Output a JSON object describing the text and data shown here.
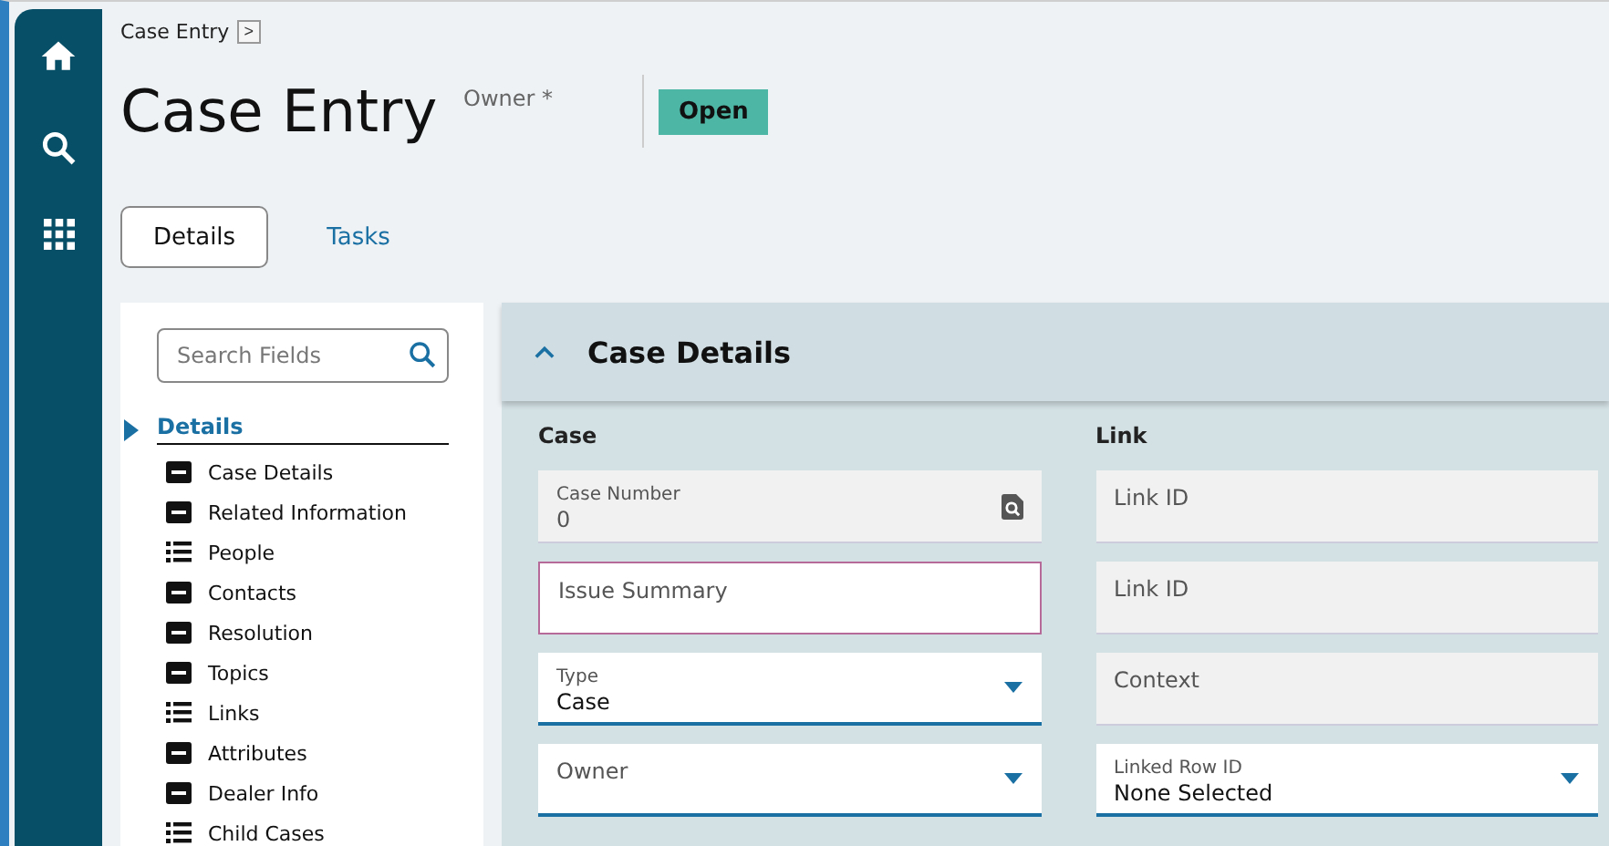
{
  "breadcrumb": {
    "label": "Case Entry",
    "chevron": ">"
  },
  "header": {
    "title": "Case Entry",
    "owner_label": "Owner *",
    "status": "Open"
  },
  "tabs": [
    {
      "label": "Details",
      "selected": true
    },
    {
      "label": "Tasks",
      "selected": false
    }
  ],
  "sidebar": {
    "search": {
      "placeholder": "Search Fields"
    },
    "section": {
      "label": "Details",
      "expanded": true
    },
    "items": [
      {
        "label": "Case Details",
        "kind": "form"
      },
      {
        "label": "Related Information",
        "kind": "form"
      },
      {
        "label": "People",
        "kind": "list"
      },
      {
        "label": "Contacts",
        "kind": "form"
      },
      {
        "label": "Resolution",
        "kind": "form"
      },
      {
        "label": "Topics",
        "kind": "form"
      },
      {
        "label": "Links",
        "kind": "list"
      },
      {
        "label": "Attributes",
        "kind": "form"
      },
      {
        "label": "Dealer Info",
        "kind": "form"
      },
      {
        "label": "Child Cases",
        "kind": "list"
      }
    ]
  },
  "panel": {
    "title": "Case Details",
    "expanded": true,
    "columns": [
      {
        "heading": "Case",
        "fields": [
          {
            "label": "Case Number",
            "value": "0",
            "kind": "lookup",
            "error": false
          },
          {
            "label": "Issue Summary",
            "kind": "text",
            "error": true
          },
          {
            "label": "Type",
            "value": "Case",
            "kind": "select",
            "error": false
          },
          {
            "label": "Owner",
            "kind": "select",
            "error": false
          }
        ]
      },
      {
        "heading": "Link",
        "fields": [
          {
            "label": "Link ID",
            "kind": "readonly",
            "error": false
          },
          {
            "label": "Link ID",
            "kind": "readonly",
            "error": false
          },
          {
            "label": "Context",
            "kind": "readonly",
            "error": false
          },
          {
            "label": "Linked Row ID",
            "value": "None Selected",
            "kind": "select",
            "error": false
          }
        ]
      }
    ]
  }
}
